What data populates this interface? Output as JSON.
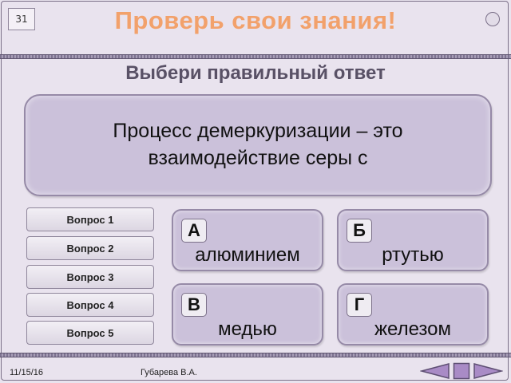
{
  "slide": {
    "number": "31",
    "title": "Проверь свои знания!",
    "subtitle": "Выбери правильный ответ"
  },
  "question": {
    "text": "Процесс демеркуризации – это взаимодействие серы с"
  },
  "question_buttons": [
    {
      "label": "Вопрос 1"
    },
    {
      "label": "Вопрос 2"
    },
    {
      "label": "Вопрос 3"
    },
    {
      "label": "Вопрос 4"
    },
    {
      "label": "Вопрос 5"
    }
  ],
  "answers": [
    {
      "letter": "А",
      "text": "алюминием"
    },
    {
      "letter": "Б",
      "text": "ртутью"
    },
    {
      "letter": "В",
      "text": "медью"
    },
    {
      "letter": "Г",
      "text": "железом"
    }
  ],
  "footer": {
    "date": "11/15/16",
    "author": "Губарева В.А."
  },
  "nav_icons": [
    "prev-arrow-icon",
    "stop-square-icon",
    "next-arrow-icon"
  ],
  "colors": {
    "title": "#f2a16b",
    "panel": "#cbc1da",
    "nav": "#a98bc6"
  }
}
